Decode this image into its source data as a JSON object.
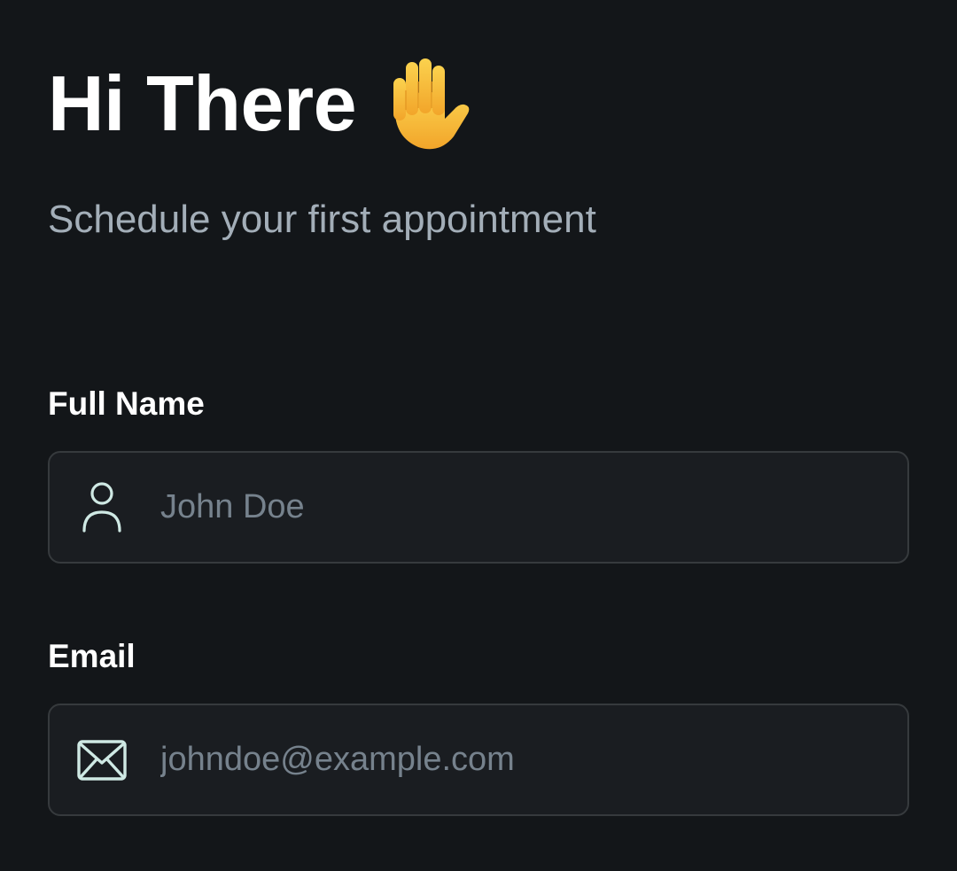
{
  "header": {
    "title": "Hi There",
    "subtitle": "Schedule your first appointment"
  },
  "form": {
    "full_name": {
      "label": "Full Name",
      "placeholder": "John Doe",
      "value": "",
      "icon": "user-icon"
    },
    "email": {
      "label": "Email",
      "placeholder": "johndoe@example.com",
      "value": "",
      "icon": "mail-icon"
    }
  },
  "colors": {
    "background": "#131619",
    "input_background": "#1a1d21",
    "input_border": "#363a3d",
    "subtitle": "#a3aeb8",
    "placeholder": "#76828d",
    "icon_stroke": "#cfe9e4",
    "emoji_yellow": "#f7c23b"
  }
}
